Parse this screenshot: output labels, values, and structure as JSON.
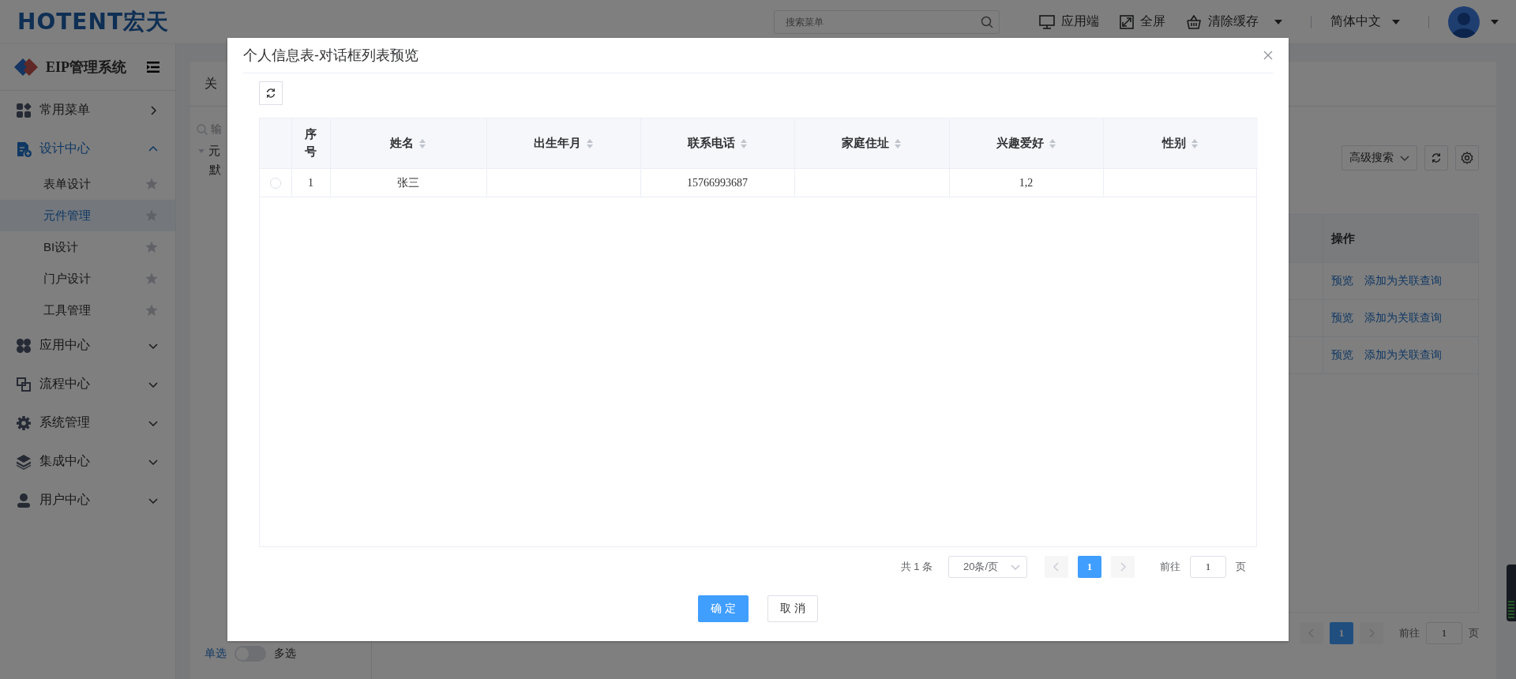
{
  "header": {
    "logo": "HOTENT宏天",
    "search_placeholder": "搜索菜单",
    "actions": [
      {
        "label": "应用端",
        "dropdown": false
      },
      {
        "label": "全屏",
        "dropdown": false
      },
      {
        "label": "清除缓存",
        "dropdown": true
      }
    ],
    "language": "简体中文"
  },
  "sidebar": {
    "title": "EIP管理系统",
    "items": [
      {
        "label": "常用菜单",
        "kind": "link"
      },
      {
        "label": "设计中心",
        "kind": "group",
        "expanded": true,
        "children": [
          {
            "label": "表单设计",
            "selected": false
          },
          {
            "label": "元件管理",
            "selected": true
          },
          {
            "label": "BI设计",
            "selected": false
          },
          {
            "label": "门户设计",
            "selected": false
          },
          {
            "label": "工具管理",
            "selected": false
          }
        ]
      },
      {
        "label": "应用中心",
        "kind": "group",
        "expanded": false
      },
      {
        "label": "流程中心",
        "kind": "group",
        "expanded": false
      },
      {
        "label": "系统管理",
        "kind": "group",
        "expanded": false
      },
      {
        "label": "集成中心",
        "kind": "group",
        "expanded": false
      },
      {
        "label": "用户中心",
        "kind": "group",
        "expanded": false
      }
    ]
  },
  "main": {
    "tab": "关",
    "tree": {
      "placeholder": "输",
      "nodes": [
        {
          "label": "元",
          "expanded": true,
          "children": [
            {
              "label": "默"
            }
          ]
        }
      ]
    },
    "toolbar": {
      "advanced_search": "高级搜索"
    },
    "table": {
      "columns": [
        "操作"
      ],
      "rows": [
        {
          "actions": [
            "预览",
            "添加为关联查询"
          ]
        },
        {
          "actions": [
            "预览",
            "添加为关联查询"
          ]
        },
        {
          "actions": [
            "预览",
            "添加为关联查询"
          ]
        }
      ]
    },
    "pagination": {
      "prev_disabled": true,
      "next_disabled": true,
      "pages": [
        {
          "label": "1",
          "selected": true
        }
      ],
      "goto_label": "前往",
      "goto_value": "1",
      "page_suffix": "页"
    },
    "select_mode": {
      "single": "单选",
      "multiple": "多选",
      "on": false
    }
  },
  "dialog": {
    "title": "个人信息表-对话框列表预览",
    "table": {
      "columns": [
        {
          "label": "序号",
          "sortable": false
        },
        {
          "label": "姓名",
          "sortable": true
        },
        {
          "label": "出生年月",
          "sortable": true
        },
        {
          "label": "联系电话",
          "sortable": true
        },
        {
          "label": "家庭住址",
          "sortable": true
        },
        {
          "label": "兴趣爱好",
          "sortable": true
        },
        {
          "label": "性别",
          "sortable": true
        }
      ],
      "rows": [
        {
          "selected": false,
          "cells": [
            "1",
            "张三",
            null,
            "15766993687",
            null,
            "1,2",
            null
          ]
        }
      ]
    },
    "pagination": {
      "total": "共 1 条",
      "page_size": "20条/页",
      "prev_disabled": true,
      "next_disabled": true,
      "pages": [
        {
          "label": "1",
          "selected": true
        }
      ],
      "goto_label": "前往",
      "goto_value": "1",
      "page_suffix": "页"
    },
    "buttons": [
      {
        "label": "确 定",
        "kind": "primary"
      },
      {
        "label": "取 消",
        "kind": "default"
      }
    ]
  }
}
